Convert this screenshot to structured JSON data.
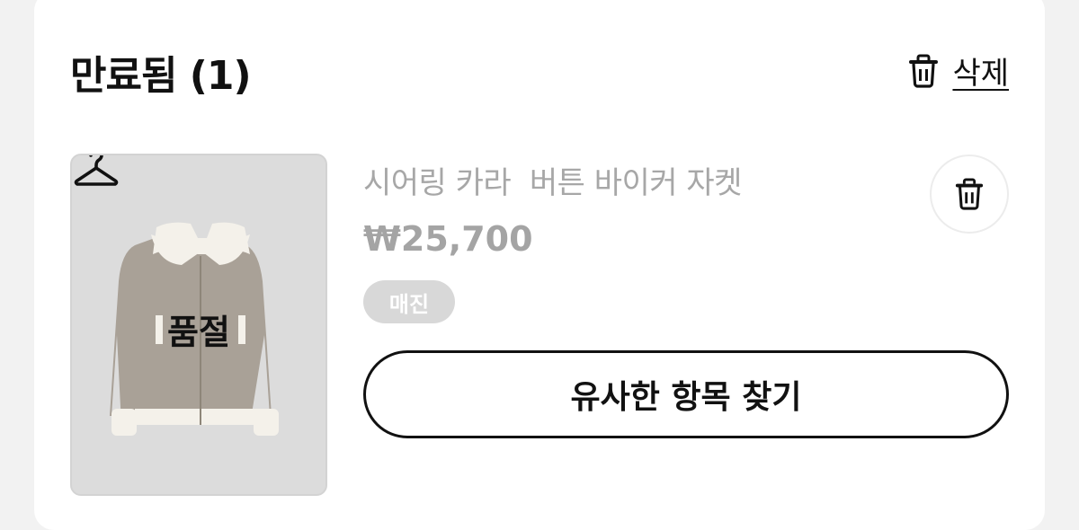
{
  "section": {
    "title": "만료됨 (1)",
    "delete_all_label": "삭제"
  },
  "item": {
    "name": "시어링 카라  버튼 바이커 자켓",
    "price": "₩25,700",
    "badge": "매진",
    "status": "품절",
    "similar_button_label": "유사한 항목 찾기"
  },
  "icons": {
    "delete_all": "trash-icon",
    "item_delete": "trash-icon",
    "soldout": "hanger-icon"
  },
  "colors": {
    "muted_text": "#a7a7a7",
    "badge_bg": "#d8d8d8",
    "primary_text": "#111111"
  }
}
